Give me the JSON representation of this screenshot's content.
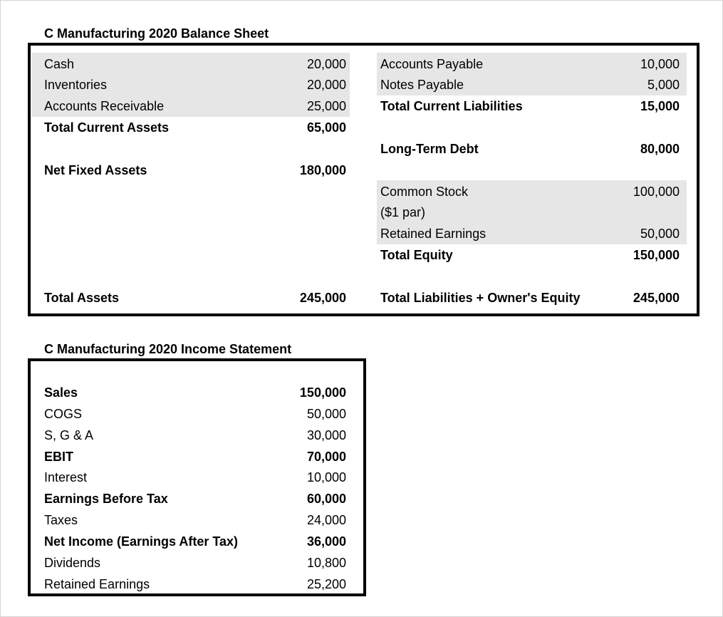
{
  "balance_sheet": {
    "title": "C Manufacturing 2020 Balance Sheet",
    "assets": {
      "cash": {
        "label": "Cash",
        "value": "20,000"
      },
      "inventories": {
        "label": "Inventories",
        "value": "20,000"
      },
      "accounts_receivable": {
        "label": "Accounts Receivable",
        "value": "25,000"
      },
      "total_current_assets": {
        "label": "Total Current Assets",
        "value": "65,000"
      },
      "net_fixed_assets": {
        "label": "Net Fixed Assets",
        "value": "180,000"
      },
      "total_assets": {
        "label": "Total Assets",
        "value": "245,000"
      }
    },
    "liabilities": {
      "accounts_payable": {
        "label": "Accounts Payable",
        "value": "10,000"
      },
      "notes_payable": {
        "label": "Notes Payable",
        "value": "5,000"
      },
      "total_current_liabilities": {
        "label": "Total Current Liabilities",
        "value": "15,000"
      },
      "long_term_debt": {
        "label": "Long-Term Debt",
        "value": "80,000"
      },
      "common_stock": {
        "label": "Common Stock",
        "label2": "($1 par)",
        "value": "100,000"
      },
      "retained_earnings": {
        "label": "Retained Earnings",
        "value": "50,000"
      },
      "total_equity": {
        "label": "Total Equity",
        "value": "150,000"
      },
      "total_liabilities_equity": {
        "label": "Total Liabilities + Owner's Equity",
        "value": "245,000"
      }
    }
  },
  "income_statement": {
    "title": "C Manufacturing 2020 Income Statement",
    "sales": {
      "label": "Sales",
      "value": "150,000"
    },
    "cogs": {
      "label": "COGS",
      "value": "50,000"
    },
    "sga": {
      "label": "S, G & A",
      "value": "30,000"
    },
    "ebit": {
      "label": "EBIT",
      "value": "70,000"
    },
    "interest": {
      "label": "Interest",
      "value": "10,000"
    },
    "ebt": {
      "label": "Earnings Before Tax",
      "value": "60,000"
    },
    "taxes": {
      "label": "Taxes",
      "value": "24,000"
    },
    "net_income": {
      "label": "Net Income (Earnings After Tax)",
      "value": "36,000"
    },
    "dividends": {
      "label": "Dividends",
      "value": "10,800"
    },
    "retained_earnings": {
      "label": "Retained Earnings",
      "value": "25,200"
    }
  }
}
